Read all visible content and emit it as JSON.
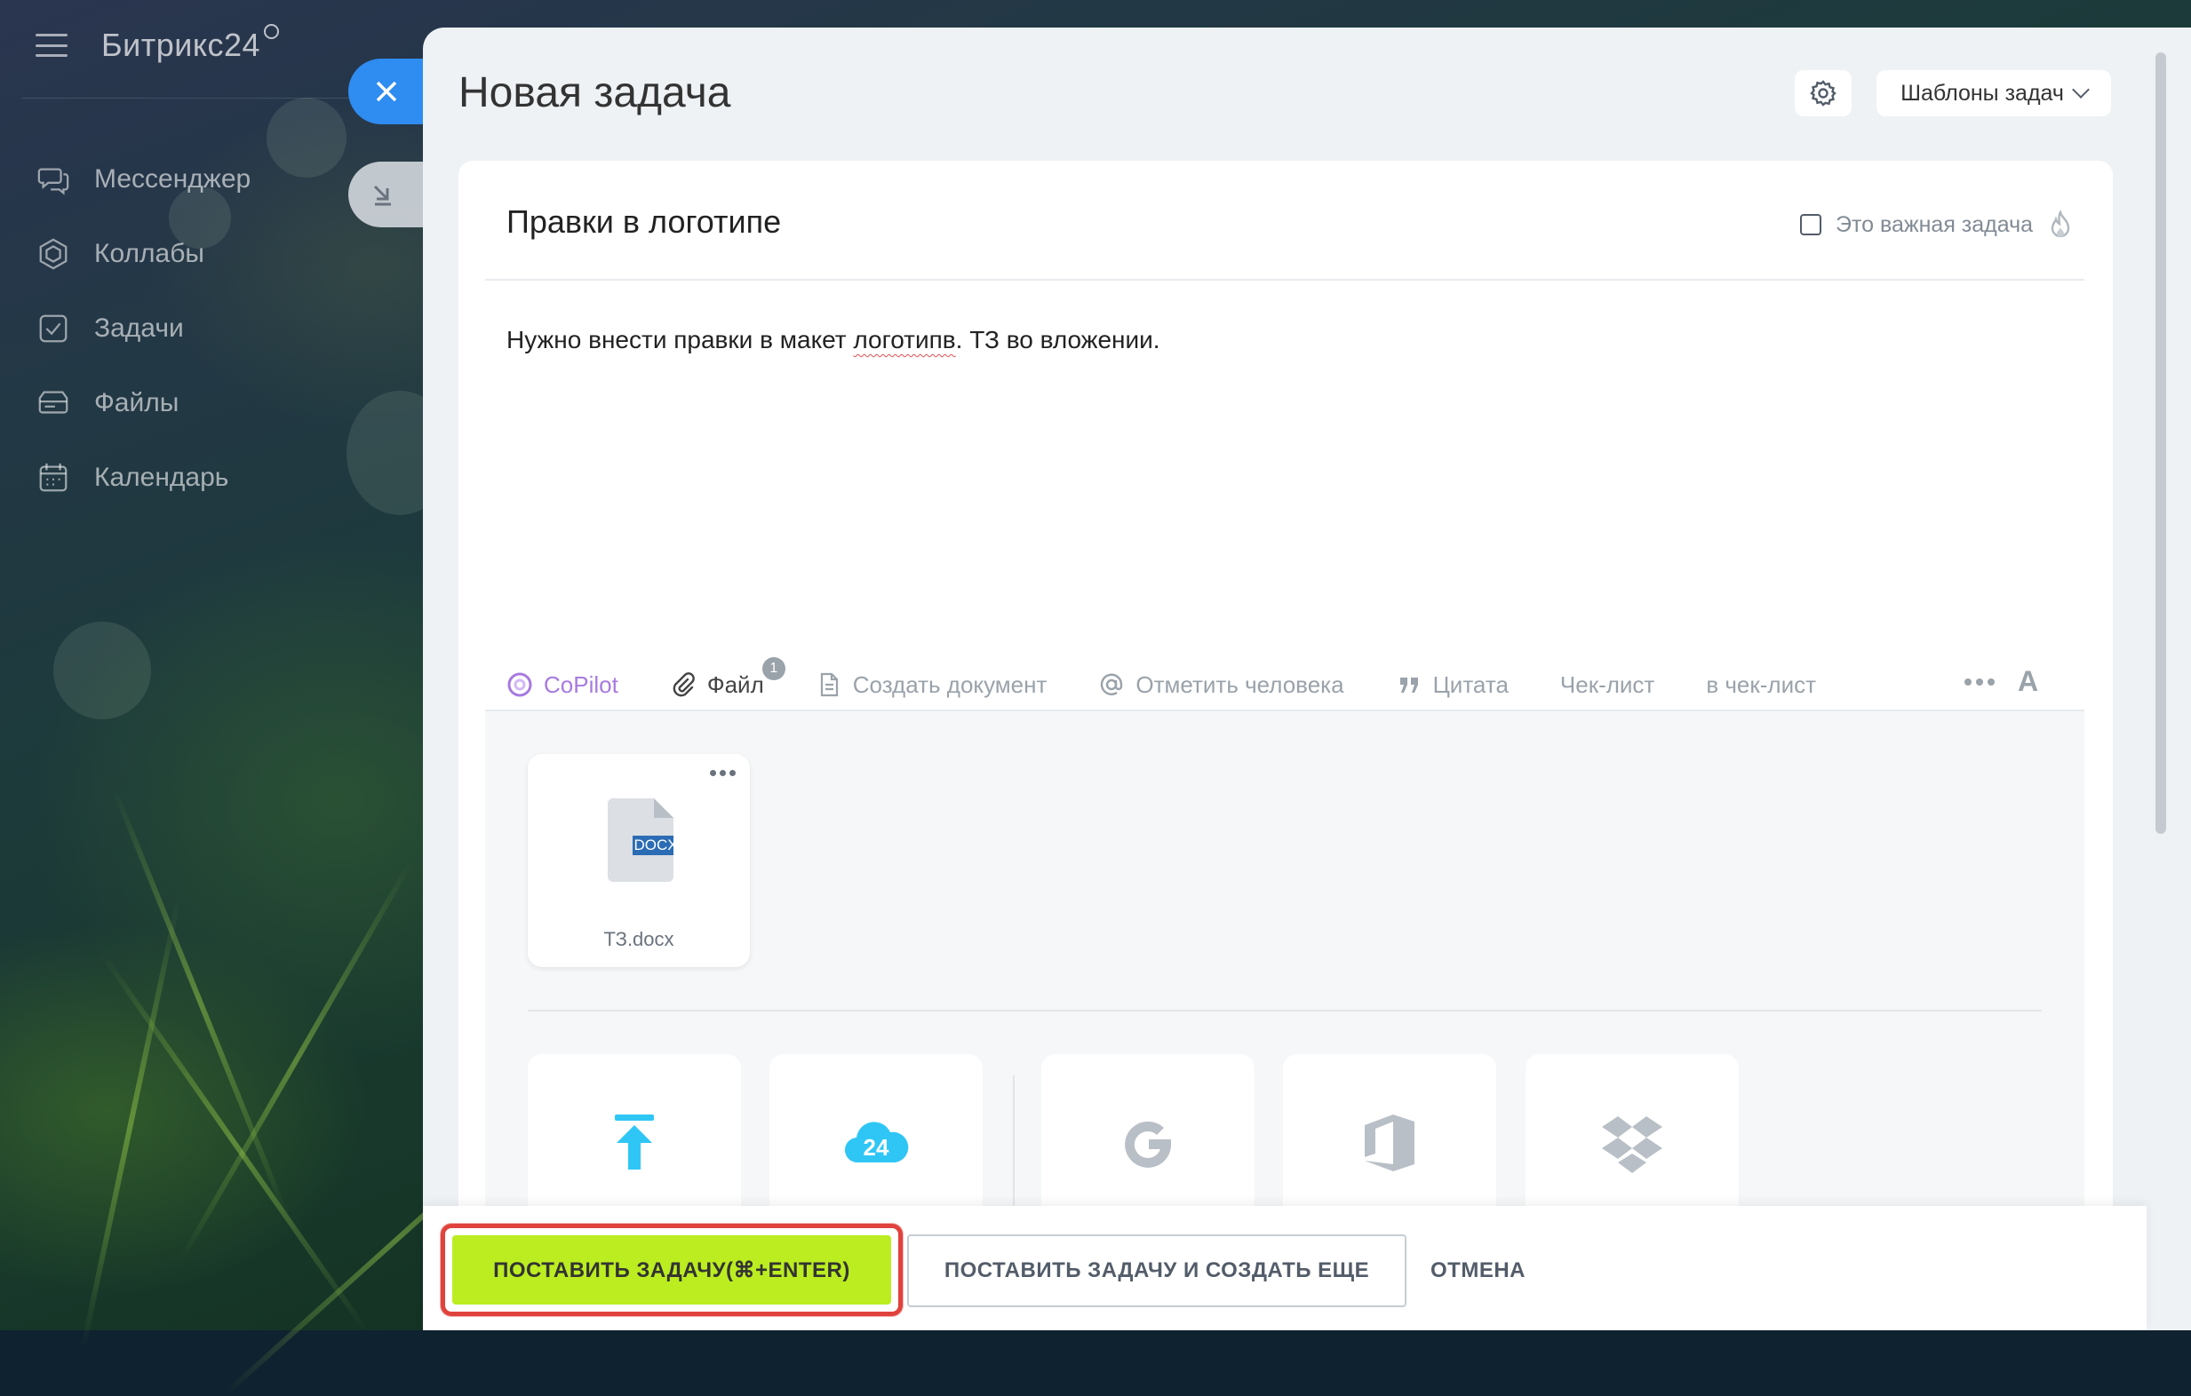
{
  "app": {
    "logo": "Битрикс24"
  },
  "sidebar": {
    "items": [
      {
        "label": "Мессенджер",
        "icon": "messenger-icon"
      },
      {
        "label": "Коллабы",
        "icon": "collab-icon"
      },
      {
        "label": "Задачи",
        "icon": "tasks-icon"
      },
      {
        "label": "Файлы",
        "icon": "files-icon"
      },
      {
        "label": "Календарь",
        "icon": "calendar-icon"
      }
    ]
  },
  "panel": {
    "title": "Новая задача",
    "templates_label": "Шаблоны задач"
  },
  "task": {
    "title": "Правки в логотипе",
    "important_label": "Это важная задача",
    "important_checked": false,
    "description_before": "Нужно внести правки в макет ",
    "description_typo": "логотипв",
    "description_after": ". ТЗ во вложении."
  },
  "toolbar": {
    "copilot": "CoPilot",
    "file": "Файл",
    "file_count": "1",
    "create_doc": "Создать документ",
    "mention": "Отметить человека",
    "quote": "Цитата",
    "checklist": "Чек-лист",
    "to_checklist": "в чек-лист"
  },
  "attachments": {
    "files": [
      {
        "name": "ТЗ.docx",
        "ext": "DOCX"
      }
    ],
    "sources": [
      "upload-icon",
      "bitrix24-cloud-icon",
      "google-drive-icon",
      "office-icon",
      "dropbox-icon"
    ]
  },
  "footer": {
    "submit": "ПОСТАВИТЬ ЗАДАЧУ(⌘+ENTER)",
    "submit_and_new": "ПОСТАВИТЬ ЗАДАЧУ И СОЗДАТЬ ЕЩЕ",
    "cancel": "ОТМЕНА"
  },
  "colors": {
    "accent_blue": "#2f8cf0",
    "submit_green": "#bbed21",
    "highlight_red": "#e0423d",
    "copilot_purple": "#a77ae0"
  }
}
